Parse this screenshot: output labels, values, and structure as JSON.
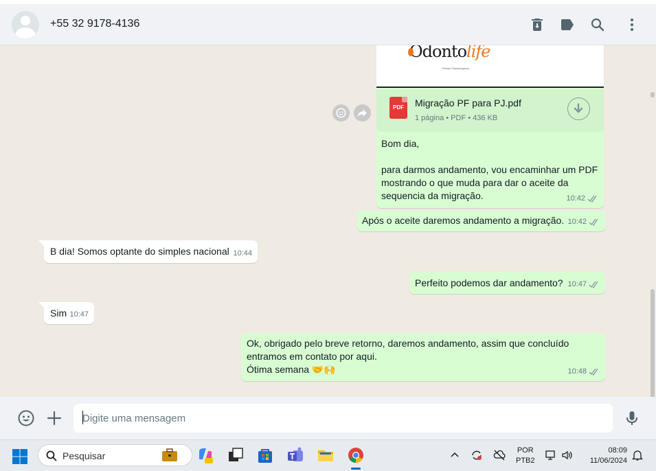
{
  "header": {
    "contact_name": "+55 32 9178-4136",
    "icons": [
      "trash-icon",
      "label-icon",
      "search-icon",
      "menu-icon"
    ]
  },
  "chat": {
    "document": {
      "preview_logo": "Odonto",
      "preview_logo_accent": "life",
      "preview_logo_sub": "Planos Odontológicos",
      "file_name": "Migração PF para PJ.pdf",
      "file_type_badge": "PDF",
      "file_info": "1 página • PDF • 436 KB",
      "caption_lines": [
        "Bom dia,",
        "",
        "para darmos andamento, vou encaminhar um PDF",
        "mostrando o que muda para dar o aceite da",
        "sequencia da migração."
      ],
      "time": "10:42"
    },
    "messages": [
      {
        "direction": "out",
        "text": "Após o aceite daremos andamento a migração.",
        "time": "10:42"
      },
      {
        "direction": "in",
        "text": "B dia! Somos optante do simples nacional",
        "time": "10:44"
      },
      {
        "direction": "out",
        "text": "Perfeito podemos dar andamento?",
        "time": "10:47"
      },
      {
        "direction": "in",
        "text": "Sim",
        "time": "10:47"
      },
      {
        "direction": "out",
        "lines": [
          "Ok, obrigado pelo breve retorno, daremos andamento, assim que concluído",
          "entramos em contato por aqui.",
          "Ótima semana 🤝🙌"
        ],
        "time": "10:48"
      }
    ]
  },
  "composer": {
    "placeholder": "Digite uma mensagem"
  },
  "taskbar": {
    "search_label": "Pesquisar",
    "lang_line1": "POR",
    "lang_line2": "PTB2",
    "time": "08:09",
    "date": "11/06/2024"
  },
  "colors": {
    "outgoing_bubble": "#d9fdd3",
    "incoming_bubble": "#ffffff",
    "chat_background": "#efeae2",
    "header_background": "#f0f2f5",
    "pdf_red": "#e53935"
  }
}
